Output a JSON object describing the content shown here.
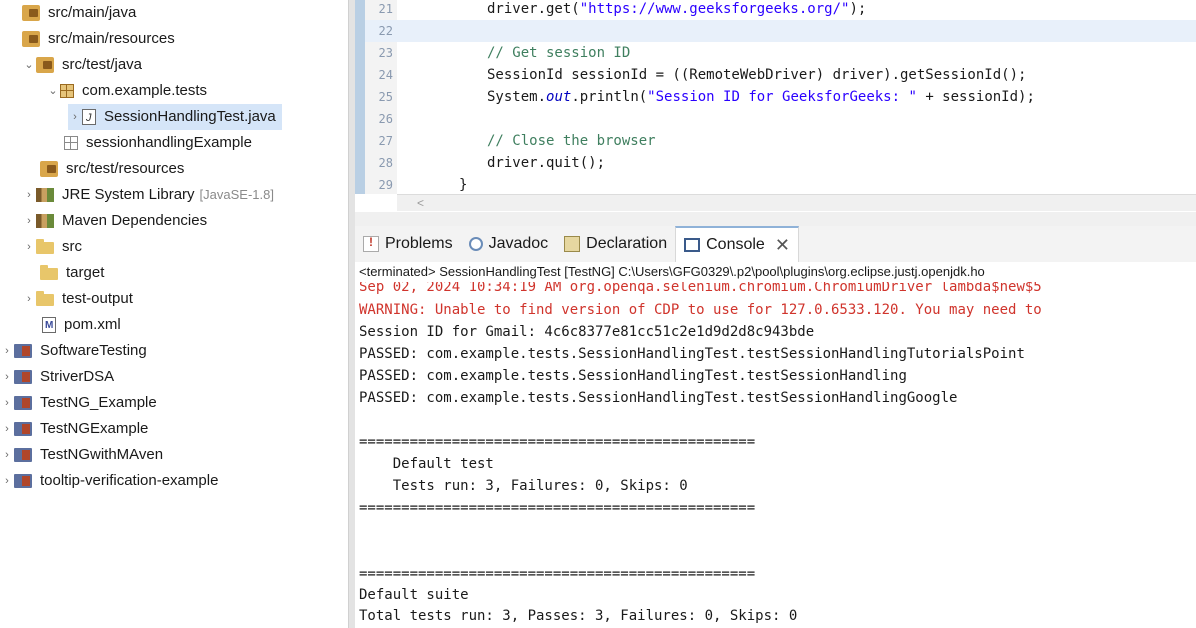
{
  "explorer": {
    "items": [
      {
        "label": "src/main/java",
        "icon": "source-folder-icon"
      },
      {
        "label": "src/main/resources",
        "icon": "source-folder-icon"
      },
      {
        "label": "src/test/java",
        "icon": "source-folder-icon"
      },
      {
        "label": "com.example.tests",
        "icon": "package-icon"
      },
      {
        "label": "SessionHandlingTest.java",
        "icon": "java-file-icon"
      },
      {
        "label": "sessionhandlingExample",
        "icon": "empty-package-icon"
      },
      {
        "label": "src/test/resources",
        "icon": "source-folder-icon"
      },
      {
        "label": "JRE System Library",
        "suffix": "[JavaSE-1.8]",
        "icon": "library-icon"
      },
      {
        "label": "Maven Dependencies",
        "icon": "library-icon"
      },
      {
        "label": "src",
        "icon": "folder-icon"
      },
      {
        "label": "target",
        "icon": "folder-icon"
      },
      {
        "label": "test-output",
        "icon": "folder-icon"
      },
      {
        "label": "pom.xml",
        "icon": "xml-file-icon"
      },
      {
        "label": "SoftwareTesting",
        "icon": "project-icon"
      },
      {
        "label": "StriverDSA",
        "icon": "project-icon"
      },
      {
        "label": "TestNG_Example",
        "icon": "project-icon"
      },
      {
        "label": "TestNGExample",
        "icon": "project-icon"
      },
      {
        "label": "TestNGwithMAven",
        "icon": "project-icon"
      },
      {
        "label": "tooltip-verification-example",
        "icon": "project-icon"
      }
    ]
  },
  "editor": {
    "line_numbers": [
      "21",
      "22",
      "23",
      "24",
      "25",
      "26",
      "27",
      "28",
      "29"
    ],
    "l21": {
      "a": "driver.get(",
      "b": "\"https://www.geeksforgeeks.org/\"",
      "c": ");"
    },
    "l23": "// Get session ID",
    "l24": "SessionId sessionId = ((RemoteWebDriver) driver).getSessionId();",
    "l25": {
      "a": "System.",
      "b": "out",
      "c": ".println(",
      "d": "\"Session ID for GeeksforGeeks: \"",
      "e": " + sessionId);"
    },
    "l27": "// Close the browser",
    "l28": "driver.quit();",
    "l29": "}",
    "scroll_arrow": "<"
  },
  "tabs": {
    "problems": "Problems",
    "javadoc": "Javadoc",
    "declaration": "Declaration",
    "console": "Console",
    "close_glyph": "✕"
  },
  "console": {
    "header": "<terminated> SessionHandlingTest [TestNG] C:\\Users\\GFG0329\\.p2\\pool\\plugins\\org.eclipse.justj.openjdk.ho",
    "lines": [
      "Sep 02, 2024 10:34:19 AM org.openqa.selenium.chromium.ChromiumDriver lambda$new$5",
      "WARNING: Unable to find version of CDP to use for 127.0.6533.120. You may need to",
      "Session ID for Gmail: 4c6c8377e81cc51c2e1d9d2d8c943bde",
      "PASSED: com.example.tests.SessionHandlingTest.testSessionHandlingTutorialsPoint",
      "PASSED: com.example.tests.SessionHandlingTest.testSessionHandling",
      "PASSED: com.example.tests.SessionHandlingTest.testSessionHandlingGoogle",
      "",
      "===============================================",
      "    Default test",
      "    Tests run: 3, Failures: 0, Skips: 0",
      "===============================================",
      "",
      "",
      "===============================================",
      "Default suite",
      "Total tests run: 3, Passes: 3, Failures: 0, Skips: 0"
    ]
  },
  "colors": {
    "keyword": "#7f0055",
    "string": "#2a00ff",
    "comment": "#3f7f5f",
    "error": "#d0342c",
    "selection": "#d5e5f8"
  }
}
